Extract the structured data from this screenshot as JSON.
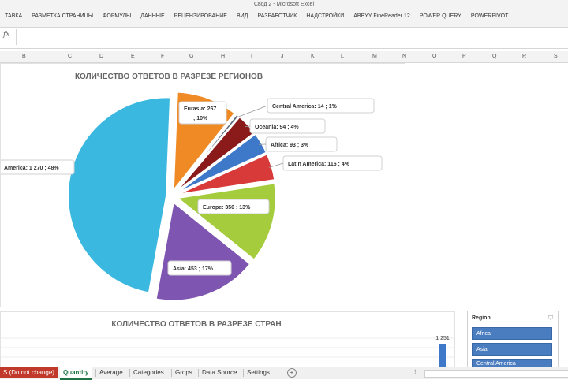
{
  "window": {
    "title": "Свод 2 - Microsoft Excel"
  },
  "ribbon_tabs": [
    "ТАВКА",
    "РАЗМЕТКА СТРАНИЦЫ",
    "ФОРМУЛЫ",
    "ДАННЫЕ",
    "РЕЦЕНЗИРОВАНИЕ",
    "ВИД",
    "РАЗРАБОТЧИК",
    "НАДСТРОЙКИ",
    "ABBYY FineReader 12",
    "POWER QUERY",
    "POWERPIVOT"
  ],
  "formula_bar": {
    "fx": "fx",
    "value": ""
  },
  "columns": [
    "B",
    "C",
    "D",
    "E",
    "F",
    "G",
    "H",
    "I",
    "J",
    "K",
    "L",
    "M",
    "N",
    "O",
    "P",
    "Q",
    "R",
    "S"
  ],
  "chart_data": [
    {
      "type": "pie",
      "title": "КОЛИЧЕСТВО ОТВЕТОВ В РАЗРЕЗЕ РЕГИОНОВ",
      "slices": [
        {
          "label": "America",
          "value": 1270,
          "value_text": "1 270",
          "pct": "48%",
          "color": "#3ab8e0"
        },
        {
          "label": "Eurasia",
          "value": 267,
          "value_text": "267",
          "pct": "10%",
          "color": "#f08a24"
        },
        {
          "label": "Central America",
          "value": 14,
          "value_text": "14",
          "pct": "1%",
          "color": "#5a6a7a"
        },
        {
          "label": "Oceania",
          "value": 94,
          "value_text": "94",
          "pct": "4%",
          "color": "#8b1a1a"
        },
        {
          "label": "Africa",
          "value": 93,
          "value_text": "93",
          "pct": "3%",
          "color": "#3d78c9"
        },
        {
          "label": "Latin America",
          "value": 116,
          "value_text": "116",
          "pct": "4%",
          "color": "#d83a3a"
        },
        {
          "label": "Europe",
          "value": 350,
          "value_text": "350",
          "pct": "13%",
          "color": "#a5cc3c"
        },
        {
          "label": "Asia",
          "value": 453,
          "value_text": "453",
          "pct": "17%",
          "color": "#7e55b0"
        }
      ]
    },
    {
      "type": "bar",
      "title": "КОЛИЧЕСТВО ОТВЕТОВ В РАЗРЕЗЕ СТРАН",
      "values": [
        1251
      ],
      "value_labels": [
        "1 251"
      ],
      "color": "#3d78c9"
    }
  ],
  "slicer": {
    "title": "Region",
    "items": [
      "Africa",
      "Asia",
      "Central America"
    ]
  },
  "sheet_tabs": [
    "S (Do not change)",
    "Quantity",
    "Average",
    "Categories",
    "Grops",
    "Data Source",
    "Settings"
  ],
  "status": {
    "plus": "+",
    "dots": "⁝"
  }
}
